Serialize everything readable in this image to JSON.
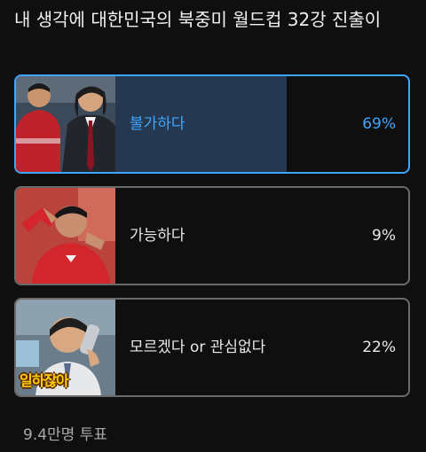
{
  "poll": {
    "question": "내 생각에 대한민국의 북중미 월드컵 32강 진출이",
    "options": [
      {
        "label": "불가하다",
        "percent": "69%",
        "fill_fraction": 0.69,
        "selected": true,
        "image": "coach-and-player-photo"
      },
      {
        "label": "가능하다",
        "percent": "9%",
        "fill_fraction": 0.09,
        "selected": false,
        "image": "player-hand-gesture-photo"
      },
      {
        "label": "모르겠다 or 관심없다",
        "percent": "22%",
        "fill_fraction": 0.22,
        "selected": false,
        "image": "man-on-phone-photo"
      }
    ],
    "votes": "9.4만명 투표"
  },
  "colors": {
    "background": "#0f0f0f",
    "selected_accent": "#3ea6ff",
    "selected_fill": "#263850",
    "bar_fill": "#2c2c2c",
    "border": "#6b6b6b"
  }
}
